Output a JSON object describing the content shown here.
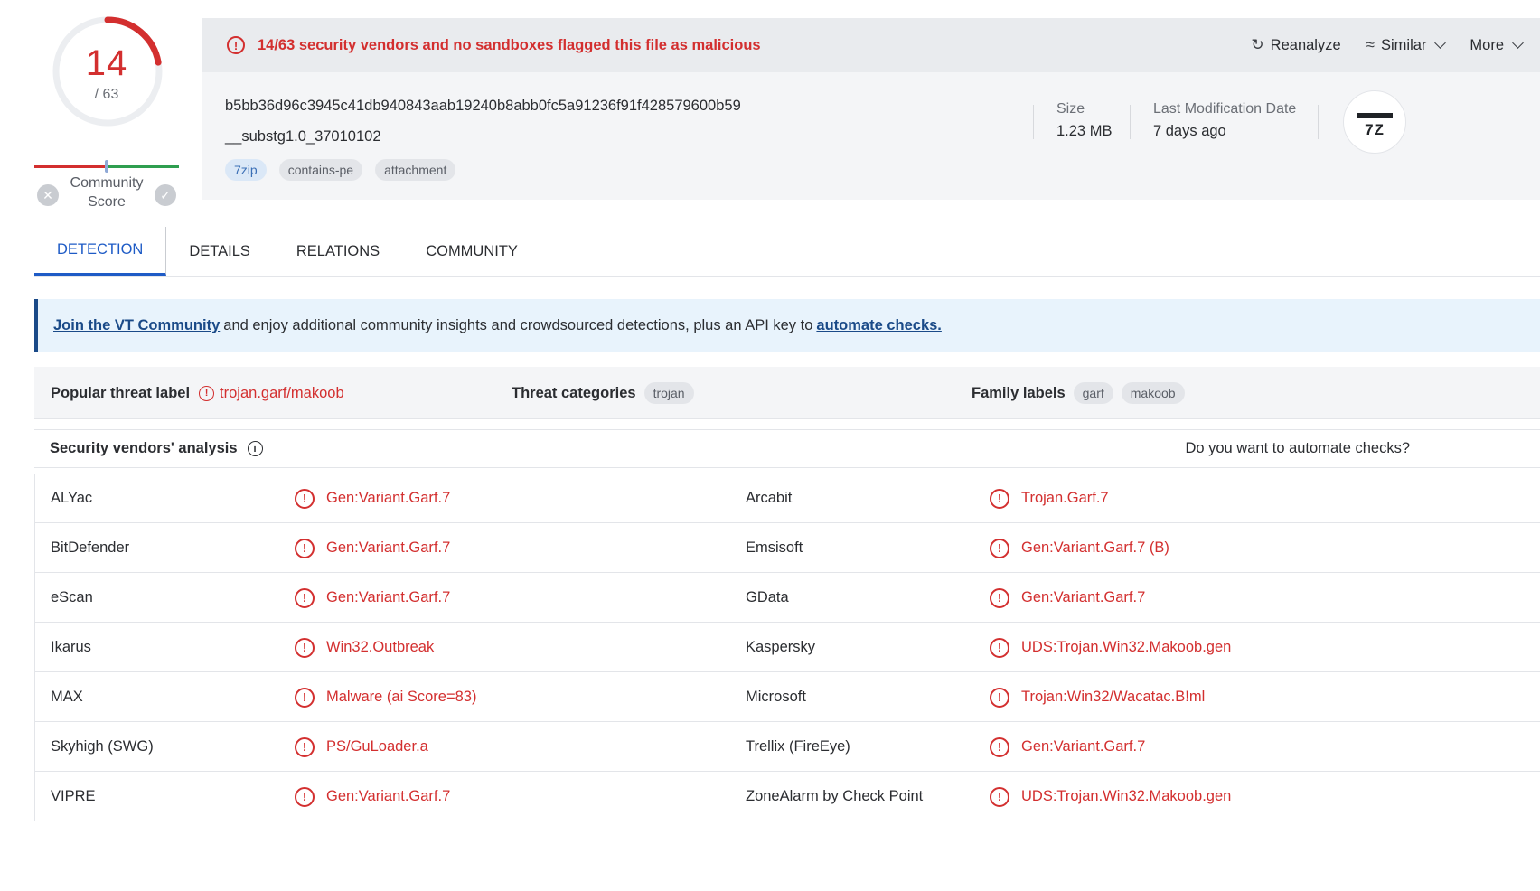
{
  "score": {
    "detected": "14",
    "total": "/ 63",
    "detection_fraction": 0.222,
    "community_label": "Community Score",
    "community_level": 0.5
  },
  "alert": {
    "text": "14/63 security vendors and no sandboxes flagged this file as malicious",
    "actions": {
      "reanalyze": "Reanalyze",
      "similar": "Similar",
      "more": "More"
    }
  },
  "file": {
    "hash": "b5bb36d96c3945c41db940843aab19240b8abb0fc5a91236f91f428579600b59",
    "name": "__substg1.0_37010102",
    "tags": [
      "7zip",
      "contains-pe",
      "attachment"
    ],
    "size_label": "Size",
    "size_value": "1.23 MB",
    "modified_label": "Last Modification Date",
    "modified_value": "7 days ago",
    "type_icon_label": "7Z"
  },
  "tabs": [
    "DETECTION",
    "DETAILS",
    "RELATIONS",
    "COMMUNITY"
  ],
  "banner": {
    "link1": "Join the VT Community",
    "middle": "and enjoy additional community insights and crowdsourced detections, plus an API key to",
    "link2": "automate checks."
  },
  "threat": {
    "popular_label_title": "Popular threat label",
    "popular_label_value": "trojan.garf/makoob",
    "categories_title": "Threat categories",
    "categories": [
      "trojan"
    ],
    "family_title": "Family labels",
    "family": [
      "garf",
      "makoob"
    ]
  },
  "vendors": {
    "title": "Security vendors' analysis",
    "automate_prompt": "Do you want to automate checks?",
    "rows": [
      {
        "left_vendor": "ALYac",
        "left_result": "Gen:Variant.Garf.7",
        "right_vendor": "Arcabit",
        "right_result": "Trojan.Garf.7"
      },
      {
        "left_vendor": "BitDefender",
        "left_result": "Gen:Variant.Garf.7",
        "right_vendor": "Emsisoft",
        "right_result": "Gen:Variant.Garf.7 (B)"
      },
      {
        "left_vendor": "eScan",
        "left_result": "Gen:Variant.Garf.7",
        "right_vendor": "GData",
        "right_result": "Gen:Variant.Garf.7"
      },
      {
        "left_vendor": "Ikarus",
        "left_result": "Win32.Outbreak",
        "right_vendor": "Kaspersky",
        "right_result": "UDS:Trojan.Win32.Makoob.gen"
      },
      {
        "left_vendor": "MAX",
        "left_result": "Malware (ai Score=83)",
        "right_vendor": "Microsoft",
        "right_result": "Trojan:Win32/Wacatac.B!ml"
      },
      {
        "left_vendor": "Skyhigh (SWG)",
        "left_result": "PS/GuLoader.a",
        "right_vendor": "Trellix (FireEye)",
        "right_result": "Gen:Variant.Garf.7"
      },
      {
        "left_vendor": "VIPRE",
        "left_result": "Gen:Variant.Garf.7",
        "right_vendor": "ZoneAlarm by Check Point",
        "right_result": "UDS:Trojan.Win32.Makoob.gen"
      }
    ]
  },
  "colors": {
    "malicious": "#d32f2f",
    "accent": "#1e5bc6",
    "banner_bg": "#e8f3fc",
    "card_bg": "#f4f5f7"
  }
}
